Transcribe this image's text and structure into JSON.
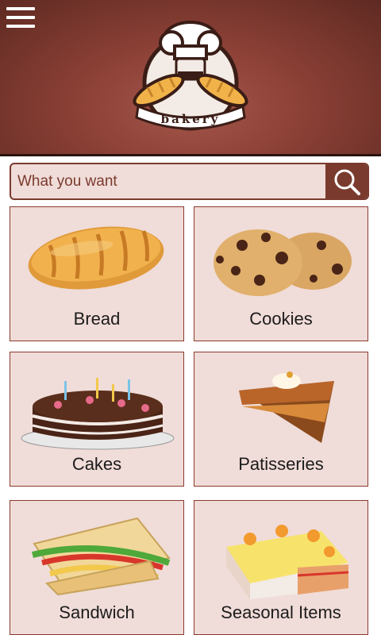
{
  "header": {
    "logo_text": "bakery"
  },
  "search": {
    "placeholder": "What you want"
  },
  "categories": [
    {
      "label": "Bread"
    },
    {
      "label": "Cookies"
    },
    {
      "label": "Cakes"
    },
    {
      "label": "Patisseries"
    },
    {
      "label": "Sandwich"
    },
    {
      "label": "Seasonal Items"
    }
  ],
  "colors": {
    "header": "#8a3f35",
    "accent": "#7a3b2e",
    "tile_bg": "#f0dcd8"
  },
  "icons": {
    "menu": "menu-icon",
    "search": "search-icon"
  }
}
